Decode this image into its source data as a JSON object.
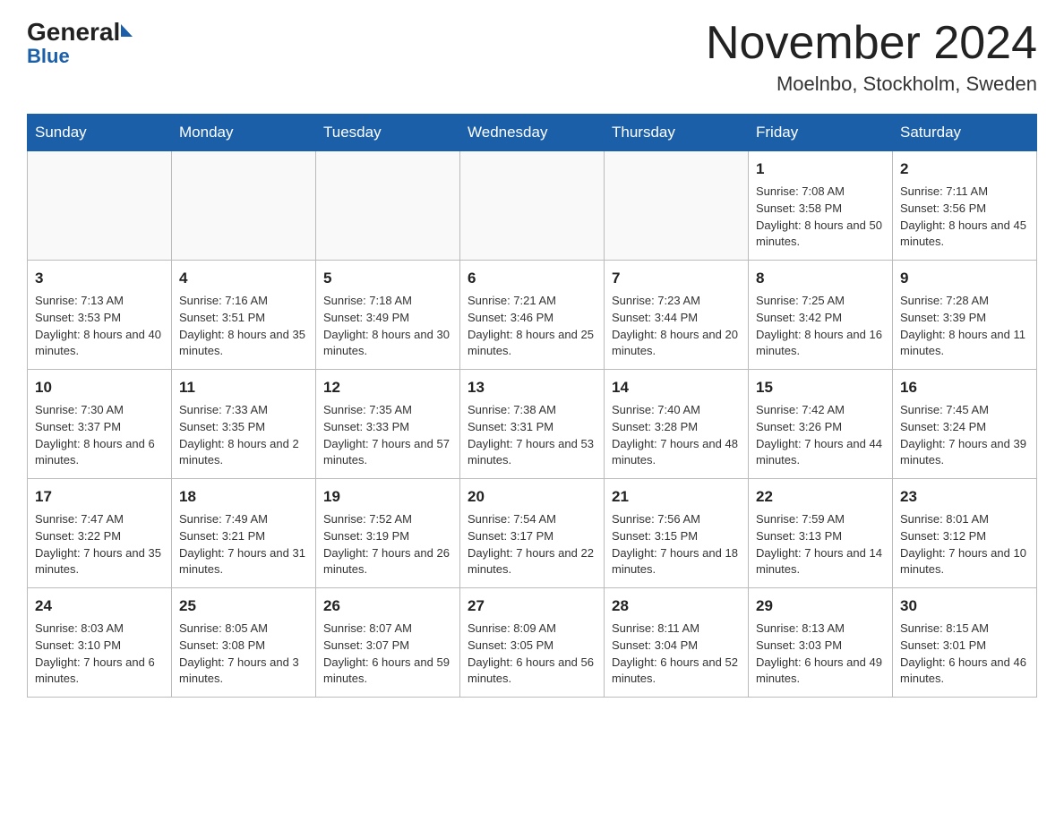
{
  "header": {
    "logo_general": "General",
    "logo_blue": "Blue",
    "month_title": "November 2024",
    "location": "Moelnbo, Stockholm, Sweden"
  },
  "days_of_week": [
    "Sunday",
    "Monday",
    "Tuesday",
    "Wednesday",
    "Thursday",
    "Friday",
    "Saturday"
  ],
  "weeks": [
    [
      {
        "day": "",
        "sunrise": "",
        "sunset": "",
        "daylight": ""
      },
      {
        "day": "",
        "sunrise": "",
        "sunset": "",
        "daylight": ""
      },
      {
        "day": "",
        "sunrise": "",
        "sunset": "",
        "daylight": ""
      },
      {
        "day": "",
        "sunrise": "",
        "sunset": "",
        "daylight": ""
      },
      {
        "day": "",
        "sunrise": "",
        "sunset": "",
        "daylight": ""
      },
      {
        "day": "1",
        "sunrise": "Sunrise: 7:08 AM",
        "sunset": "Sunset: 3:58 PM",
        "daylight": "Daylight: 8 hours and 50 minutes."
      },
      {
        "day": "2",
        "sunrise": "Sunrise: 7:11 AM",
        "sunset": "Sunset: 3:56 PM",
        "daylight": "Daylight: 8 hours and 45 minutes."
      }
    ],
    [
      {
        "day": "3",
        "sunrise": "Sunrise: 7:13 AM",
        "sunset": "Sunset: 3:53 PM",
        "daylight": "Daylight: 8 hours and 40 minutes."
      },
      {
        "day": "4",
        "sunrise": "Sunrise: 7:16 AM",
        "sunset": "Sunset: 3:51 PM",
        "daylight": "Daylight: 8 hours and 35 minutes."
      },
      {
        "day": "5",
        "sunrise": "Sunrise: 7:18 AM",
        "sunset": "Sunset: 3:49 PM",
        "daylight": "Daylight: 8 hours and 30 minutes."
      },
      {
        "day": "6",
        "sunrise": "Sunrise: 7:21 AM",
        "sunset": "Sunset: 3:46 PM",
        "daylight": "Daylight: 8 hours and 25 minutes."
      },
      {
        "day": "7",
        "sunrise": "Sunrise: 7:23 AM",
        "sunset": "Sunset: 3:44 PM",
        "daylight": "Daylight: 8 hours and 20 minutes."
      },
      {
        "day": "8",
        "sunrise": "Sunrise: 7:25 AM",
        "sunset": "Sunset: 3:42 PM",
        "daylight": "Daylight: 8 hours and 16 minutes."
      },
      {
        "day": "9",
        "sunrise": "Sunrise: 7:28 AM",
        "sunset": "Sunset: 3:39 PM",
        "daylight": "Daylight: 8 hours and 11 minutes."
      }
    ],
    [
      {
        "day": "10",
        "sunrise": "Sunrise: 7:30 AM",
        "sunset": "Sunset: 3:37 PM",
        "daylight": "Daylight: 8 hours and 6 minutes."
      },
      {
        "day": "11",
        "sunrise": "Sunrise: 7:33 AM",
        "sunset": "Sunset: 3:35 PM",
        "daylight": "Daylight: 8 hours and 2 minutes."
      },
      {
        "day": "12",
        "sunrise": "Sunrise: 7:35 AM",
        "sunset": "Sunset: 3:33 PM",
        "daylight": "Daylight: 7 hours and 57 minutes."
      },
      {
        "day": "13",
        "sunrise": "Sunrise: 7:38 AM",
        "sunset": "Sunset: 3:31 PM",
        "daylight": "Daylight: 7 hours and 53 minutes."
      },
      {
        "day": "14",
        "sunrise": "Sunrise: 7:40 AM",
        "sunset": "Sunset: 3:28 PM",
        "daylight": "Daylight: 7 hours and 48 minutes."
      },
      {
        "day": "15",
        "sunrise": "Sunrise: 7:42 AM",
        "sunset": "Sunset: 3:26 PM",
        "daylight": "Daylight: 7 hours and 44 minutes."
      },
      {
        "day": "16",
        "sunrise": "Sunrise: 7:45 AM",
        "sunset": "Sunset: 3:24 PM",
        "daylight": "Daylight: 7 hours and 39 minutes."
      }
    ],
    [
      {
        "day": "17",
        "sunrise": "Sunrise: 7:47 AM",
        "sunset": "Sunset: 3:22 PM",
        "daylight": "Daylight: 7 hours and 35 minutes."
      },
      {
        "day": "18",
        "sunrise": "Sunrise: 7:49 AM",
        "sunset": "Sunset: 3:21 PM",
        "daylight": "Daylight: 7 hours and 31 minutes."
      },
      {
        "day": "19",
        "sunrise": "Sunrise: 7:52 AM",
        "sunset": "Sunset: 3:19 PM",
        "daylight": "Daylight: 7 hours and 26 minutes."
      },
      {
        "day": "20",
        "sunrise": "Sunrise: 7:54 AM",
        "sunset": "Sunset: 3:17 PM",
        "daylight": "Daylight: 7 hours and 22 minutes."
      },
      {
        "day": "21",
        "sunrise": "Sunrise: 7:56 AM",
        "sunset": "Sunset: 3:15 PM",
        "daylight": "Daylight: 7 hours and 18 minutes."
      },
      {
        "day": "22",
        "sunrise": "Sunrise: 7:59 AM",
        "sunset": "Sunset: 3:13 PM",
        "daylight": "Daylight: 7 hours and 14 minutes."
      },
      {
        "day": "23",
        "sunrise": "Sunrise: 8:01 AM",
        "sunset": "Sunset: 3:12 PM",
        "daylight": "Daylight: 7 hours and 10 minutes."
      }
    ],
    [
      {
        "day": "24",
        "sunrise": "Sunrise: 8:03 AM",
        "sunset": "Sunset: 3:10 PM",
        "daylight": "Daylight: 7 hours and 6 minutes."
      },
      {
        "day": "25",
        "sunrise": "Sunrise: 8:05 AM",
        "sunset": "Sunset: 3:08 PM",
        "daylight": "Daylight: 7 hours and 3 minutes."
      },
      {
        "day": "26",
        "sunrise": "Sunrise: 8:07 AM",
        "sunset": "Sunset: 3:07 PM",
        "daylight": "Daylight: 6 hours and 59 minutes."
      },
      {
        "day": "27",
        "sunrise": "Sunrise: 8:09 AM",
        "sunset": "Sunset: 3:05 PM",
        "daylight": "Daylight: 6 hours and 56 minutes."
      },
      {
        "day": "28",
        "sunrise": "Sunrise: 8:11 AM",
        "sunset": "Sunset: 3:04 PM",
        "daylight": "Daylight: 6 hours and 52 minutes."
      },
      {
        "day": "29",
        "sunrise": "Sunrise: 8:13 AM",
        "sunset": "Sunset: 3:03 PM",
        "daylight": "Daylight: 6 hours and 49 minutes."
      },
      {
        "day": "30",
        "sunrise": "Sunrise: 8:15 AM",
        "sunset": "Sunset: 3:01 PM",
        "daylight": "Daylight: 6 hours and 46 minutes."
      }
    ]
  ]
}
